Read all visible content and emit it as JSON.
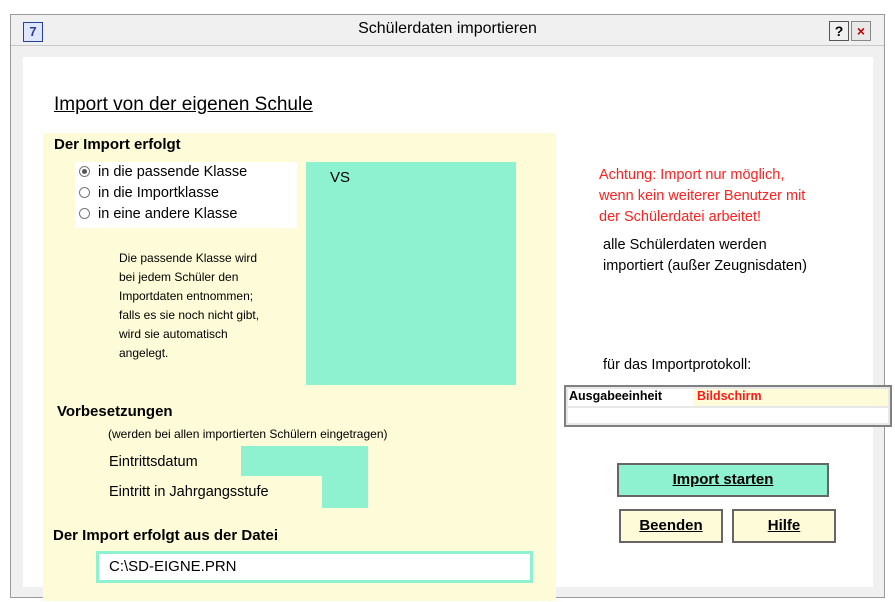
{
  "window": {
    "title": "Schülerdaten importieren",
    "app_icon_label": "7",
    "help_glyph": "?",
    "close_glyph": "×"
  },
  "main": {
    "heading": "Import von der eigenen Schule",
    "import_section": {
      "title": "Der Import erfolgt",
      "options": [
        {
          "label": "in die passende Klasse",
          "selected": true
        },
        {
          "label": "in die Importklasse",
          "selected": false
        },
        {
          "label": "in eine andere Klasse",
          "selected": false
        }
      ],
      "class_value": "VS",
      "info_lines": [
        "Die passende Klasse wird",
        "bei jedem Schüler den",
        "Importdaten entnommen;",
        "falls es sie noch nicht gibt,",
        "wird sie automatisch",
        "angelegt."
      ]
    },
    "preset_section": {
      "title": "Vorbesetzungen",
      "hint": "(werden bei allen importierten Schülern eingetragen)",
      "entry_date_label": "Eintrittsdatum",
      "entry_date_value": "",
      "entry_level_label": "Eintritt in Jahrgangsstufe",
      "entry_level_value": ""
    },
    "file_section": {
      "title": "Der Import erfolgt aus der Datei",
      "path": "C:\\SD-EIGNE.PRN"
    }
  },
  "right": {
    "warning_lines": [
      "Achtung: Import nur möglich,",
      "wenn kein weiterer Benutzer mit",
      "der Schülerdatei arbeitet!"
    ],
    "note_lines": [
      "alle Schülerdaten werden",
      "importiert (außer Zeugnisdaten)"
    ],
    "protocol_label": "für das Importprotokoll:",
    "output_label": "Ausgabeeinheit",
    "output_value": "Bildschirm"
  },
  "buttons": {
    "import_start": "Import starten",
    "exit": "Beenden",
    "help": "Hilfe"
  },
  "colors": {
    "teal": "#8ef1cf",
    "panel_yellow": "#fefcd8",
    "warning_red": "#ff2020"
  }
}
